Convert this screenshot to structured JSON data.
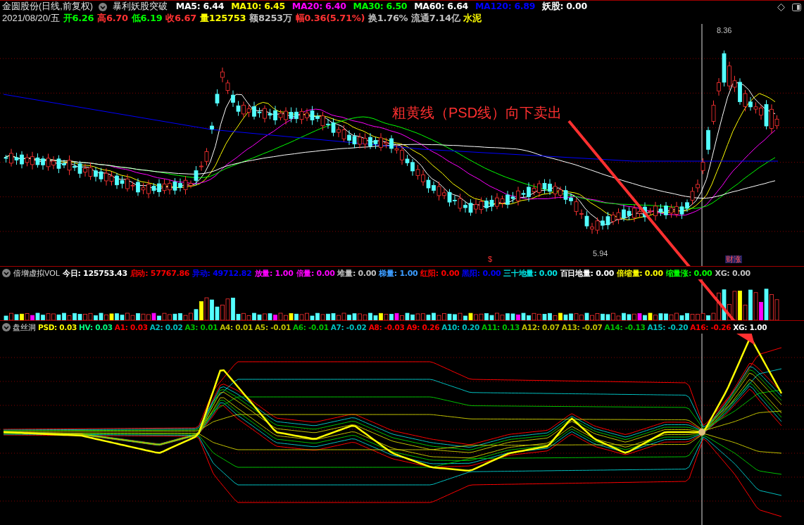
{
  "header": {
    "title": "金圆股份(日线,前复权)",
    "formula": "暴利妖股突破",
    "indicators": [
      {
        "text": "MA5: 6.44",
        "color": "#ffffff"
      },
      {
        "text": "MA10: 6.45",
        "color": "#ffff00"
      },
      {
        "text": "MA20: 6.40",
        "color": "#ff00ff"
      },
      {
        "text": "MA30: 6.50",
        "color": "#00ff00"
      },
      {
        "text": "MA60: 6.64",
        "color": "#ffffff"
      },
      {
        "text": "MA120: 6.89",
        "color": "#0000ff"
      },
      {
        "text": "妖股: 0.00",
        "color": "#ffffff"
      }
    ]
  },
  "quote": {
    "date": "2021/08/20/五",
    "items": [
      {
        "text": "开6.26",
        "color": "#00ff00"
      },
      {
        "text": "高6.70",
        "color": "#ff3232"
      },
      {
        "text": "低6.19",
        "color": "#00ff00"
      },
      {
        "text": "收6.67",
        "color": "#ff3232"
      },
      {
        "text": "量125753",
        "color": "#ffff00"
      },
      {
        "text": "额8253万",
        "color": "#c0c0c0"
      },
      {
        "text": "幅0.36(5.71%)",
        "color": "#ff3232"
      },
      {
        "text": "换1.76%",
        "color": "#c0c0c0"
      },
      {
        "text": "流通7.14亿",
        "color": "#c0c0c0"
      },
      {
        "text": "水泥",
        "color": "#ffff00"
      }
    ]
  },
  "price_chart": {
    "high_label": "8.36",
    "low_label": "5.94",
    "marker": "$",
    "event_tag": "财涨",
    "annotation": "粗黄线（PSD线）向下卖出"
  },
  "volume_panel": {
    "name": "倍增虚拟VOL",
    "fields": [
      {
        "text": "今日: 125753.43",
        "color": "#ffffff"
      },
      {
        "text": "启动: 57767.86",
        "color": "#ff0000"
      },
      {
        "text": "异动: 49712.82",
        "color": "#0000ff"
      },
      {
        "text": "放量: 1.00",
        "color": "#ff00ff"
      },
      {
        "text": "倍量: 0.00",
        "color": "#ff00ff"
      },
      {
        "text": "堆量: 0.00",
        "color": "#c0c0c0"
      },
      {
        "text": "梯量: 1.00",
        "color": "#3c9cff"
      },
      {
        "text": "红阳: 0.00",
        "color": "#ff0000"
      },
      {
        "text": "黑阳: 0.00",
        "color": "#0000ff"
      },
      {
        "text": "三十地量: 0.00",
        "color": "#00e0e0"
      },
      {
        "text": "百日地量: 0.00",
        "color": "#ffffff"
      },
      {
        "text": "倍缩量: 0.00",
        "color": "#ffff00"
      },
      {
        "text": "缩量涨: 0.00",
        "color": "#00ff00"
      },
      {
        "text": "XG: 0.00",
        "color": "#c0c0c0"
      }
    ]
  },
  "indicator_panel": {
    "name": "盘丝洞",
    "fields": [
      {
        "text": "PSD: 0.03",
        "color": "#ffff00"
      },
      {
        "text": "HV: 0.03",
        "color": "#00ff80"
      },
      {
        "text": "A1: 0.03",
        "color": "#ff0000"
      },
      {
        "text": "A2: 0.02",
        "color": "#00c0c0"
      },
      {
        "text": "A3: 0.01",
        "color": "#00c000"
      },
      {
        "text": "A4: 0.01",
        "color": "#c0c000"
      },
      {
        "text": "A5: -0.01",
        "color": "#c0c000"
      },
      {
        "text": "A6: -0.01",
        "color": "#00c000"
      },
      {
        "text": "A7: -0.02",
        "color": "#00c0c0"
      },
      {
        "text": "A8: -0.03",
        "color": "#ff0000"
      },
      {
        "text": "A9: 0.26",
        "color": "#ff0000"
      },
      {
        "text": "A10: 0.20",
        "color": "#00c0c0"
      },
      {
        "text": "A11: 0.13",
        "color": "#00c000"
      },
      {
        "text": "A12: 0.07",
        "color": "#c0c000"
      },
      {
        "text": "A13: -0.07",
        "color": "#c0c000"
      },
      {
        "text": "A14: -0.13",
        "color": "#00c000"
      },
      {
        "text": "A15: -0.20",
        "color": "#00c0c0"
      },
      {
        "text": "A16: -0.26",
        "color": "#ff0000"
      },
      {
        "text": "XG: 1.00",
        "color": "#ffffff"
      }
    ]
  }
}
